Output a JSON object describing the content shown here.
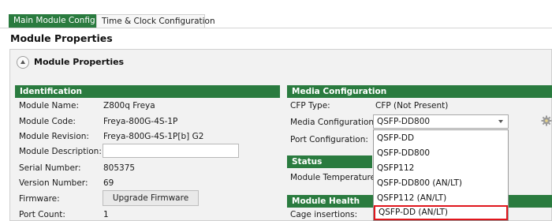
{
  "tabs": [
    {
      "label": "Main Module Config",
      "active": true
    },
    {
      "label": "Time & Clock Configuration",
      "active": false
    }
  ],
  "page_title": "Module Properties",
  "panel_title": "Module Properties",
  "identification": {
    "header": "Identification",
    "rows": [
      {
        "label": "Module Name:",
        "value": "Z800q Freya"
      },
      {
        "label": "Module Code:",
        "value": "Freya-800G-4S-1P"
      },
      {
        "label": "Module Revision:",
        "value": "Freya-800G-4S-1P[b] G2"
      },
      {
        "label": "Module Description:",
        "value": ""
      },
      {
        "label": "Serial Number:",
        "value": "805375"
      },
      {
        "label": "Version Number:",
        "value": "69"
      },
      {
        "label": "Firmware:",
        "value": ""
      },
      {
        "label": "Port Count:",
        "value": "1"
      }
    ],
    "upgrade_button": "Upgrade Firmware"
  },
  "media": {
    "header": "Media Configuration",
    "cfp_type_label": "CFP Type:",
    "cfp_type_value": "CFP (Not Present)",
    "media_config_label": "Media Configuration:",
    "media_config_value": "QSFP-DD800",
    "port_config_label": "Port Configuration:"
  },
  "status": {
    "header": "Status",
    "module_temp_label": "Module Temperature:"
  },
  "health": {
    "header": "Module Health",
    "cage_insertions_label": "Cage insertions:"
  },
  "dropdown_options": [
    "QSFP-DD",
    "QSFP-DD800",
    "QSFP112",
    "QSFP-DD800 (AN/LT)",
    "QSFP112 (AN/LT)",
    "QSFP-DD (AN/LT)"
  ],
  "highlight_color": "#e0171d",
  "accent_color": "#2a7b3f",
  "icons": {
    "collapse": "chevron-up-icon",
    "settings": "gear-icon"
  }
}
